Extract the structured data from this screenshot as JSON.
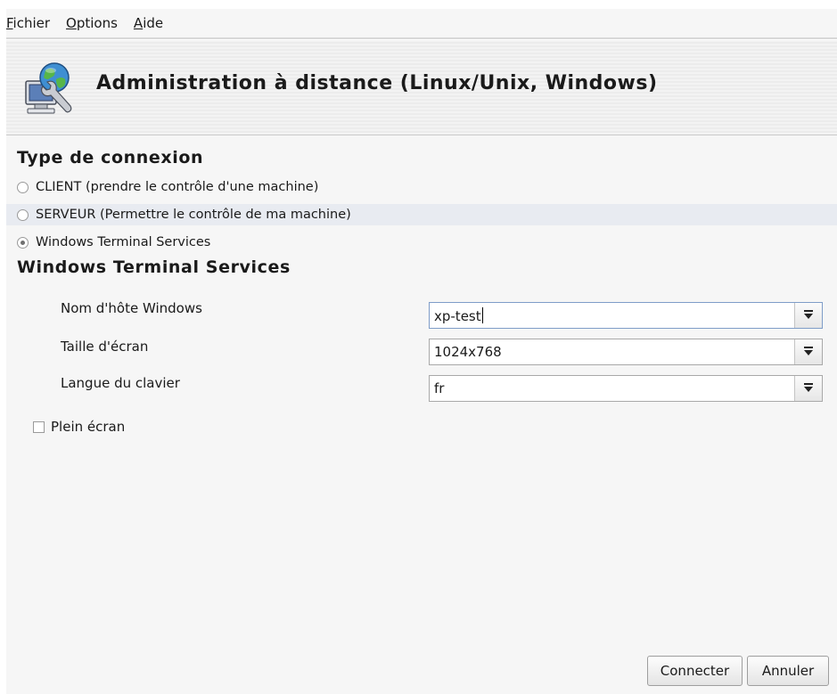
{
  "menubar": {
    "items": [
      {
        "mnemonic": "F",
        "rest": "ichier"
      },
      {
        "mnemonic": "O",
        "rest": "ptions"
      },
      {
        "mnemonic": "A",
        "rest": "ide"
      }
    ]
  },
  "banner": {
    "title": "Administration à distance (Linux/Unix, Windows)",
    "icon": "remote-admin-icon"
  },
  "connection_type": {
    "title": "Type de connexion",
    "options": [
      {
        "label": "CLIENT (prendre le contrôle d'une machine)",
        "selected": false
      },
      {
        "label": "SERVEUR (Permettre le contrôle de ma machine)",
        "selected": false
      },
      {
        "label": "Windows Terminal Services",
        "selected": true
      }
    ]
  },
  "wts": {
    "title": "Windows Terminal Services",
    "hostname_label": "Nom d'hôte Windows",
    "hostname_value": "xp-test",
    "screen_size_label": "Taille d'écran",
    "screen_size_value": "1024x768",
    "keyboard_label": "Langue du clavier",
    "keyboard_value": "fr",
    "fullscreen_label": "Plein écran",
    "fullscreen_checked": false
  },
  "buttons": {
    "connect": "Connecter",
    "cancel": "Annuler"
  },
  "colors": {
    "highlight_row": "#e8ebf1",
    "window_bg": "#f6f6f6",
    "focus_border": "#7f9dc8"
  }
}
